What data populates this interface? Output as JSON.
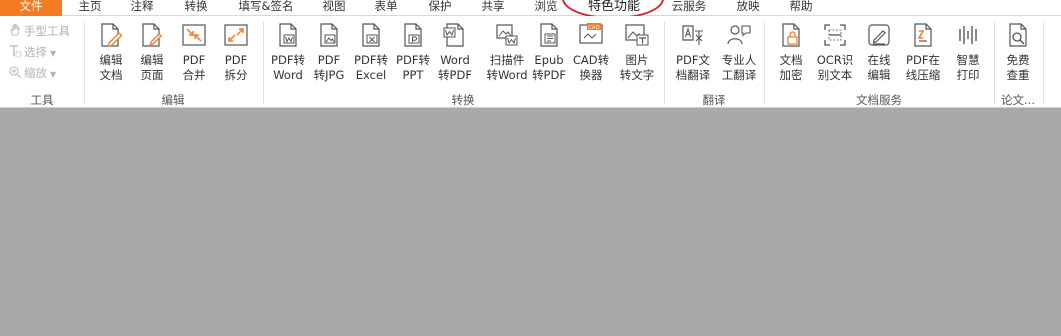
{
  "menu": {
    "file": "文件",
    "tabs": [
      "主页",
      "注释",
      "转换",
      "填写&签名",
      "视图",
      "表单",
      "保护",
      "共享",
      "浏览",
      "特色功能",
      "云服务",
      "放映",
      "帮助"
    ]
  },
  "tools_group": {
    "hand": "手型工具",
    "select": "选择",
    "zoom": "缩放",
    "label": "工具"
  },
  "groups": {
    "edit": "编辑",
    "convert": "转换",
    "translate": "翻译",
    "docservice": "文档服务",
    "paper": "论文..."
  },
  "buttons": {
    "edit_doc": "编辑\n文档",
    "edit_page": "编辑\n页面",
    "pdf_merge": "PDF\n合并",
    "pdf_split": "PDF\n拆分",
    "pdf_to_word": "PDF转\nWord",
    "pdf_to_jpg": "PDF\n转JPG",
    "pdf_to_excel": "PDF转\nExcel",
    "pdf_to_ppt": "PDF转\nPPT",
    "word_to_pdf": "Word\n转PDF",
    "scan_to_word": "扫描件\n转Word",
    "epub_to_pdf": "Epub\n转PDF",
    "cad_converter": "CAD转\n换器",
    "image_to_text": "图片\n转文字",
    "pdf_translate": "PDF文\n档翻译",
    "human_translate": "专业人\n工翻译",
    "doc_encrypt": "文档\n加密",
    "ocr": "OCR识\n别文本",
    "online_edit": "在线\n编辑",
    "online_compress": "PDF在\n线压缩",
    "smart_print": "智慧\n打印",
    "free_check": "免费\n查重"
  },
  "colors": {
    "accent_orange": "#f47b22",
    "highlight_red": "#d9232d",
    "workspace_gray": "#a9a9a9",
    "icon_gray": "#555555"
  }
}
